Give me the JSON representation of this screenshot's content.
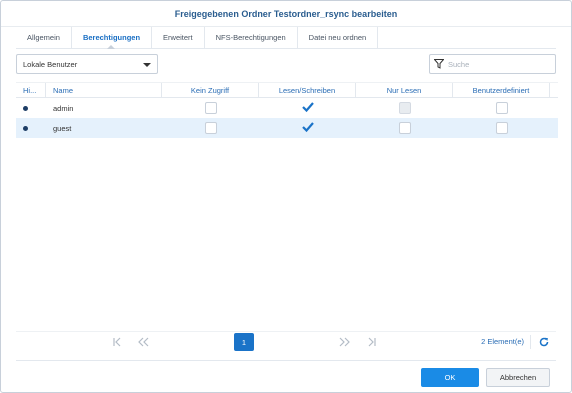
{
  "dialog": {
    "title": "Freigegebenen Ordner Testordner_rsync bearbeiten"
  },
  "tabs": [
    {
      "label": "Allgemein",
      "active": false
    },
    {
      "label": "Berechtigungen",
      "active": true
    },
    {
      "label": "Erweitert",
      "active": false
    },
    {
      "label": "NFS-Berechtigungen",
      "active": false
    },
    {
      "label": "Datei neu ordnen",
      "active": false
    }
  ],
  "toolbar": {
    "user_type": "Lokale Benutzer",
    "search_placeholder": "Suche",
    "icons": {
      "dropdown": "chevron-down-icon",
      "filter": "filter-funnel-icon"
    }
  },
  "grid": {
    "columns": [
      "Hi...",
      "Name",
      "Kein Zugriff",
      "Lesen/Schreiben",
      "Nur Lesen",
      "Benutzerdefiniert"
    ],
    "rows": [
      {
        "hidden": true,
        "name": "admin",
        "kein_zugriff": false,
        "lesen_schreiben": true,
        "nur_lesen": false,
        "nur_lesen_disabled": true,
        "benutzerdefiniert": false,
        "selected": false
      },
      {
        "hidden": true,
        "name": "guest",
        "kein_zugriff": false,
        "lesen_schreiben": true,
        "nur_lesen": false,
        "nur_lesen_disabled": false,
        "benutzerdefiniert": false,
        "selected": true
      }
    ]
  },
  "pager": {
    "current_page": "1",
    "count_label": "2 Element(e)",
    "icons": [
      "first-page-icon",
      "previous-page-icon",
      "next-page-icon",
      "last-page-icon",
      "refresh-icon"
    ]
  },
  "footer": {
    "ok_label": "OK",
    "cancel_label": "Abbrechen"
  },
  "colors": {
    "accent": "#1a73c8",
    "ok_button": "#1a8be6",
    "selected_row": "#e5f1fc",
    "title": "#2a5d8f"
  }
}
